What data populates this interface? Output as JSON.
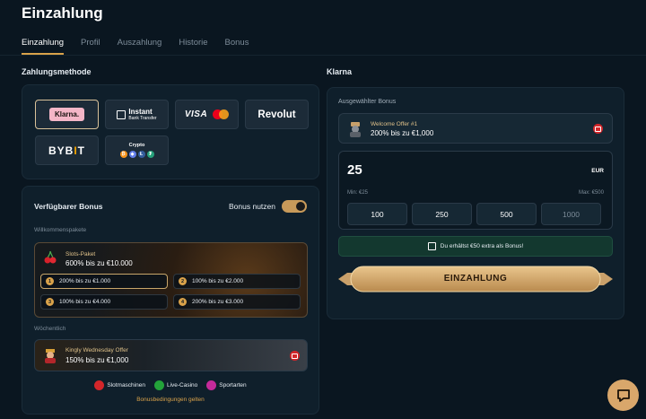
{
  "page": {
    "title": "Einzahlung"
  },
  "tabs": [
    {
      "label": "Einzahlung",
      "active": true
    },
    {
      "label": "Profil"
    },
    {
      "label": "Auszahlung"
    },
    {
      "label": "Historie"
    },
    {
      "label": "Bonus"
    }
  ],
  "payment": {
    "title": "Zahlungsmethode",
    "methods": {
      "klarna": "Klarna.",
      "instant_title": "Instant",
      "instant_sub": "Bank Transfer",
      "visa": "VISA",
      "revolut": "Revolut",
      "bybit_a": "BYB",
      "bybit_b": "I",
      "bybit_c": "T",
      "crypto": "Crypto"
    }
  },
  "bonus": {
    "title": "Verfügbarer Bonus",
    "toggle_label": "Bonus nutzen",
    "welcome_label": "Willkommenspakete",
    "slots": {
      "name": "Slots-Paket",
      "desc": "600% bis zu €10.000",
      "tiers": [
        {
          "num": "1",
          "text": "200% bis zu €1.000"
        },
        {
          "num": "2",
          "text": "100% bis zu €2.000"
        },
        {
          "num": "3",
          "text": "100% bis zu €4.000"
        },
        {
          "num": "4",
          "text": "200% bis zu €3.000"
        }
      ]
    },
    "weekly_label": "Wöchentlich",
    "kingly": {
      "name": "Kingly Wednesday Offer",
      "desc": "150% bis zu €1,000"
    },
    "categories": [
      {
        "label": "Slotmaschinen",
        "color": "#d3262a"
      },
      {
        "label": "Live-Casino",
        "color": "#23a33a"
      },
      {
        "label": "Sportarten",
        "color": "#c42a9a"
      }
    ],
    "terms": "Bonusbedingungen gelten"
  },
  "klarna": {
    "title": "Klarna",
    "selected_label": "Ausgewählter Bonus",
    "selected": {
      "name": "Welcome Offer #1",
      "desc": "200% bis zu €1,000"
    },
    "amount": "25",
    "currency": "EUR",
    "min": "Min: €25",
    "max": "Max: €500",
    "quick": [
      "100",
      "250",
      "500",
      "1000"
    ],
    "promo": "Du erhältst €50 extra als Bonus!",
    "deposit": "EINZAHLUNG"
  },
  "colors": {
    "accent": "#d9a24a",
    "panel": "#0f1f2b",
    "background": "#0a1620"
  }
}
